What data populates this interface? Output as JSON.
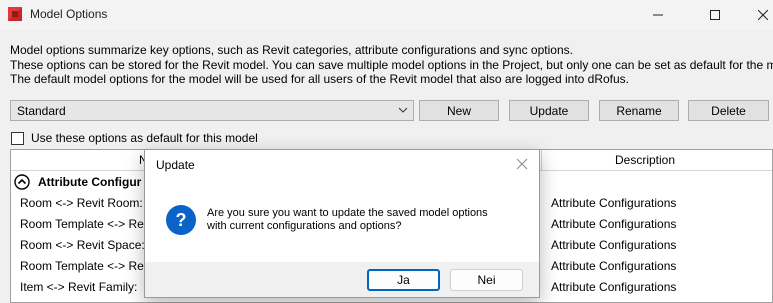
{
  "window": {
    "title": "Model Options",
    "minimize_icon": "minimize-icon",
    "maximize_icon": "maximize-icon",
    "close_icon": "close-icon"
  },
  "description": {
    "line1": "Model options summarize key options, such as Revit categories, attribute configurations and sync options.",
    "line2": "These options can be stored for the Revit model. You can save multiple model options in the Project, but only one can be set as default for the m",
    "line3": "The default model options for the model will be used for all users of the Revit model that also are logged into dRofus."
  },
  "toolbar": {
    "selected_option": "Standard",
    "new_label": "New",
    "update_label": "Update",
    "rename_label": "Rename",
    "delete_label": "Delete"
  },
  "default_checkbox": {
    "label": "Use these options as default for this model",
    "checked": false
  },
  "grid": {
    "columns": {
      "name": "N",
      "description": "Description"
    },
    "group_label": "Attribute Configur",
    "rows": [
      {
        "name": "Room <-> Revit Room:",
        "description": "Attribute Configurations"
      },
      {
        "name": "Room Template <-> Re",
        "description": "Attribute Configurations"
      },
      {
        "name": "Room <-> Revit Space:",
        "description": "Attribute Configurations"
      },
      {
        "name": "Room Template <-> Re",
        "description": "Attribute Configurations"
      },
      {
        "name": "Item <-> Revit Family:",
        "description": "Attribute Configurations"
      }
    ]
  },
  "dialog": {
    "title": "Update",
    "icon": "question-icon",
    "message_line1": "Are you sure you want to update the saved model options",
    "message_line2": "with current configurations and options?",
    "yes_label": "Ja",
    "no_label": "Nei"
  },
  "colors": {
    "accent": "#0067c0",
    "question_icon": "#0a63c6"
  }
}
